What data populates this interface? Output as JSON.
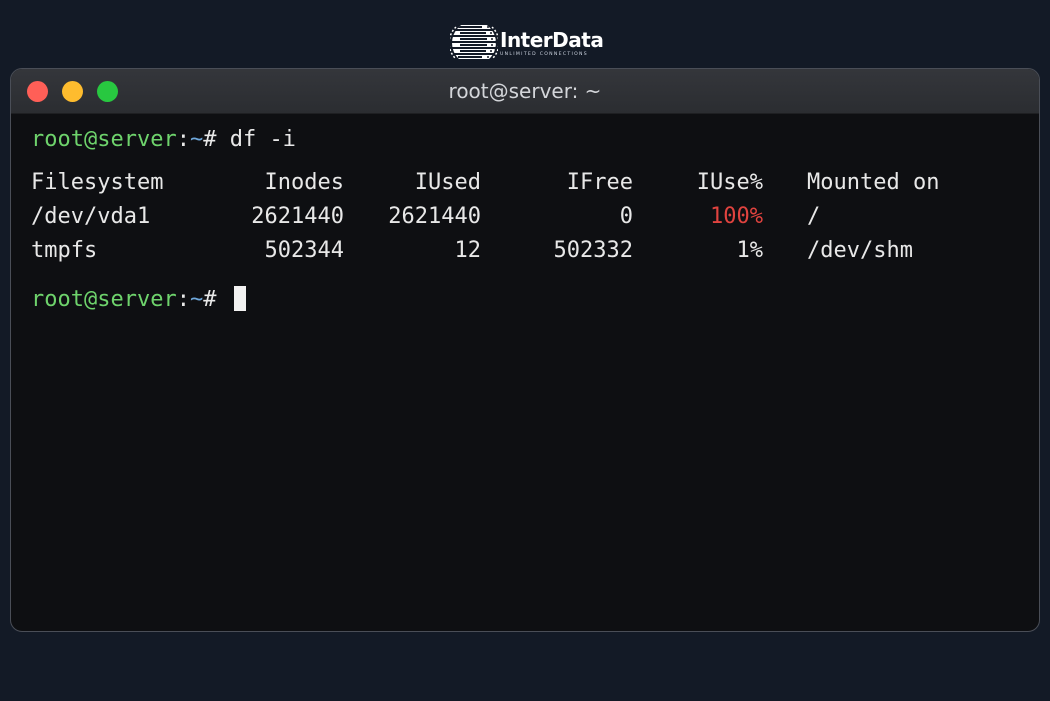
{
  "logo": {
    "name": "InterData",
    "tagline": "UNLIMITED CONNECTIONS"
  },
  "window": {
    "title": "root@server: ~"
  },
  "prompt": {
    "user_host": "root@server",
    "colon": ":",
    "path": "~",
    "hash": "#"
  },
  "command1": "df -i",
  "table": {
    "headers": [
      "Filesystem",
      "Inodes",
      "IUsed",
      "IFree",
      "IUse%",
      "Mounted on"
    ],
    "rows": [
      [
        "/dev/vda1",
        "2621440",
        "2621440",
        "0",
        "100%",
        "/"
      ],
      [
        "tmpfs",
        "502344",
        "12",
        "502332",
        "1%",
        "/dev/shm"
      ]
    ]
  },
  "colors": {
    "prompt_user": "#6ed36c",
    "prompt_path": "#6fa8dc",
    "warning": "#e0433f",
    "close": "#ff5f57",
    "minimize": "#febc2e",
    "zoom": "#28c840"
  },
  "icons": {
    "logo": "globe-stack-icon",
    "cursor": "block-cursor"
  }
}
